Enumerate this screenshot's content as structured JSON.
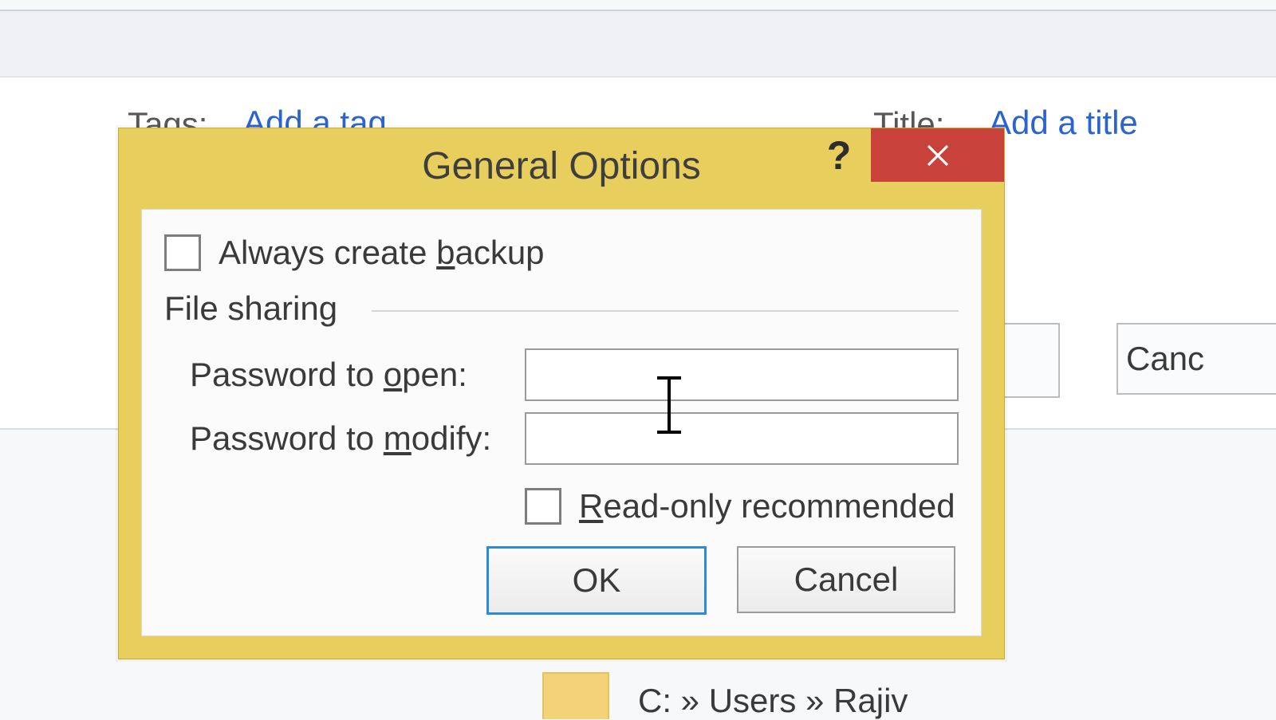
{
  "background": {
    "tags_label": "Tags:",
    "tags_value": "Add a tag",
    "title_label": "Title:",
    "title_value": "Add a title",
    "cancel_button": "Canc",
    "breadcrumb": "C: » Users » Rajiv"
  },
  "dialog": {
    "title": "General Options",
    "help_glyph": "?",
    "always_backup_pre": "Always create ",
    "always_backup_u": "b",
    "always_backup_post": "ackup",
    "group_heading": "File sharing",
    "pwd_open_pre": "Password to ",
    "pwd_open_u": "o",
    "pwd_open_post": "pen:",
    "pwd_open_value": "",
    "pwd_modify_pre": "Password to ",
    "pwd_modify_u": "m",
    "pwd_modify_post": "odify:",
    "pwd_modify_value": "",
    "readonly_u": "R",
    "readonly_post": "ead-only recommended",
    "ok": "OK",
    "cancel": "Cancel"
  }
}
